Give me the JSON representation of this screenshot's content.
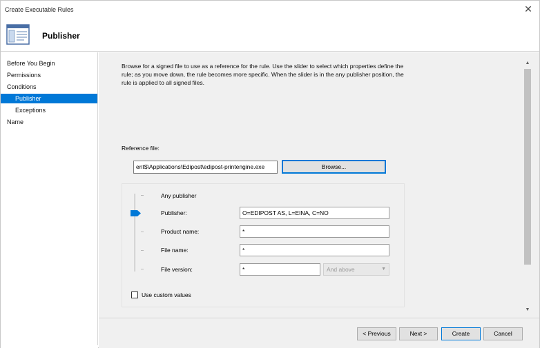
{
  "window": {
    "title": "Create Executable Rules"
  },
  "header": {
    "title": "Publisher",
    "icon": "rules-window-icon"
  },
  "sidebar": {
    "items": [
      {
        "label": "Before You Begin"
      },
      {
        "label": "Permissions"
      },
      {
        "label": "Conditions"
      },
      {
        "label": "Publisher",
        "active": true
      },
      {
        "label": "Exceptions"
      },
      {
        "label": "Name"
      }
    ]
  },
  "content": {
    "description": "Browse for a signed file to use as a reference for the rule. Use the slider to select which properties define the rule; as you move down, the rule becomes more specific. When the slider is in the any publisher position, the rule is applied to all signed files.",
    "reference_label": "Reference file:",
    "reference_value": "ent$\\Applications\\Edipost\\edipost-printengine.exe",
    "browse_label": "Browse...",
    "rows": {
      "any": {
        "label": "Any publisher"
      },
      "publisher": {
        "label": "Publisher:",
        "value": "O=EDIPOST AS, L=EINA, C=NO"
      },
      "product": {
        "label": "Product name:",
        "value": "*"
      },
      "file": {
        "label": "File name:",
        "value": "*"
      },
      "version": {
        "label": "File version:",
        "value": "*",
        "option": "And above"
      }
    },
    "slider_level": "Publisher",
    "custom_values_label": "Use custom values",
    "custom_values_checked": false
  },
  "footer": {
    "previous": "< Previous",
    "next": "Next >",
    "create": "Create",
    "cancel": "Cancel"
  },
  "colors": {
    "accent": "#0078d7",
    "panel": "#f0f0f0"
  }
}
